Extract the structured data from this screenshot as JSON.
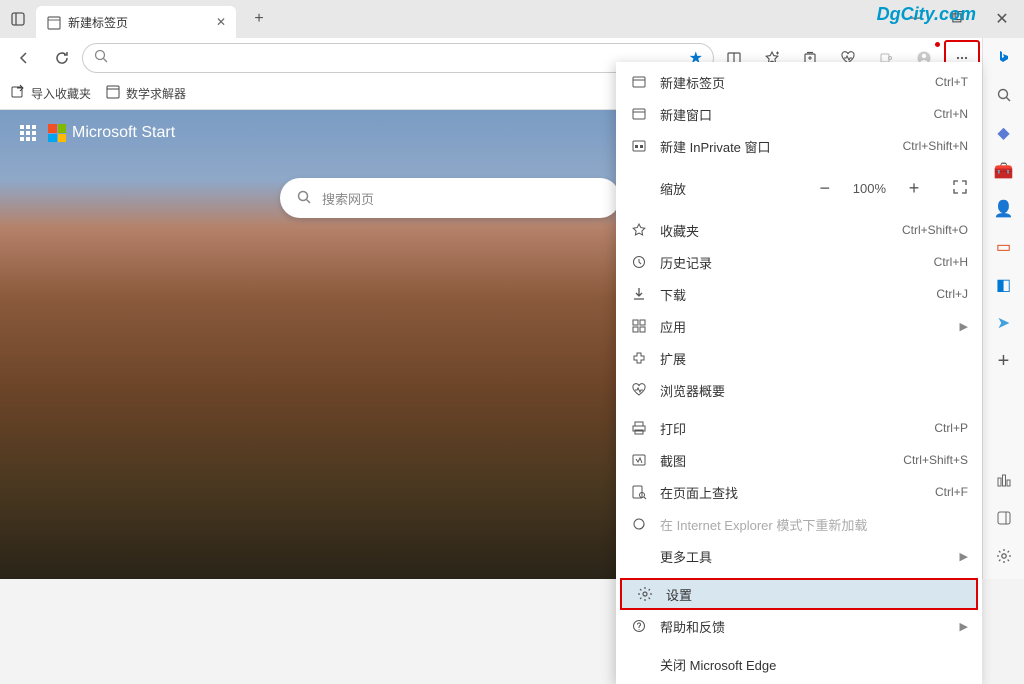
{
  "watermark": "DgCity.com",
  "tab": {
    "title": "新建标签页"
  },
  "bookmarks": {
    "import": "导入收藏夹",
    "item1": "数学求解器"
  },
  "content": {
    "brand": "Microsoft Start",
    "search_placeholder": "搜索网页"
  },
  "menu": {
    "new_tab": {
      "label": "新建标签页",
      "shortcut": "Ctrl+T"
    },
    "new_window": {
      "label": "新建窗口",
      "shortcut": "Ctrl+N"
    },
    "new_inprivate": {
      "label": "新建 InPrivate 窗口",
      "shortcut": "Ctrl+Shift+N"
    },
    "zoom": {
      "label": "缩放",
      "value": "100%"
    },
    "favorites": {
      "label": "收藏夹",
      "shortcut": "Ctrl+Shift+O"
    },
    "history": {
      "label": "历史记录",
      "shortcut": "Ctrl+H"
    },
    "downloads": {
      "label": "下载",
      "shortcut": "Ctrl+J"
    },
    "apps": {
      "label": "应用"
    },
    "extensions": {
      "label": "扩展"
    },
    "essentials": {
      "label": "浏览器概要"
    },
    "print": {
      "label": "打印",
      "shortcut": "Ctrl+P"
    },
    "screenshot": {
      "label": "截图",
      "shortcut": "Ctrl+Shift+S"
    },
    "find": {
      "label": "在页面上查找",
      "shortcut": "Ctrl+F"
    },
    "ie_mode": {
      "label": "在 Internet Explorer 模式下重新加载"
    },
    "more_tools": {
      "label": "更多工具"
    },
    "settings": {
      "label": "设置"
    },
    "help": {
      "label": "帮助和反馈"
    },
    "close": {
      "label": "关闭 Microsoft Edge"
    }
  }
}
